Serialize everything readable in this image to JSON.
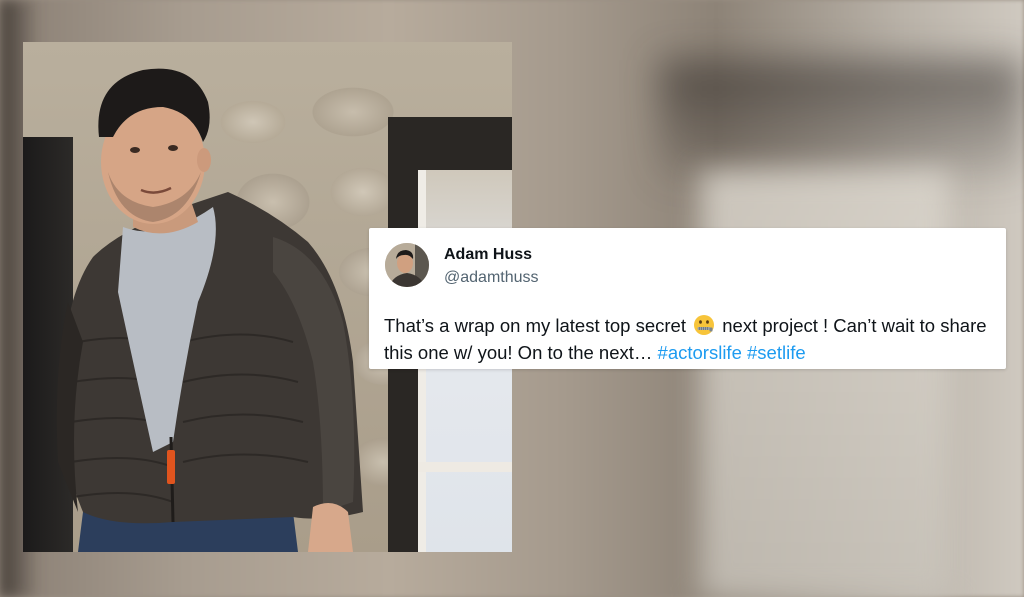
{
  "tweet": {
    "name": "Adam Huss",
    "handle": "@adamthuss",
    "text_part1": "That’s a wrap on my latest top secret",
    "emoji": "zipper-mouth-face-icon",
    "text_part2": "next project ! Can’t wait to share this one w/ you! On to the next…",
    "hashtags": [
      "#actorslife",
      "#setlife"
    ]
  },
  "colors": {
    "hashtag": "#1d9bf0",
    "name": "#0f1419",
    "handle": "#536471",
    "card": "#ffffff"
  }
}
